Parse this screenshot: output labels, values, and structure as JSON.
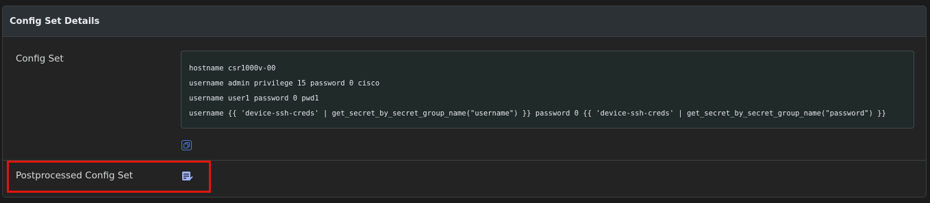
{
  "panel": {
    "title": "Config Set Details"
  },
  "config_set": {
    "label": "Config Set",
    "lines": [
      "hostname csr1000v-00",
      "username admin privilege 15 password 0 cisco",
      "username user1 password 0 pwd1",
      "username {{ 'device-ssh-creds' | get_secret_by_secret_group_name(\"username\") }} password 0 {{ 'device-ssh-creds' | get_secret_by_secret_group_name(\"password\") }}"
    ],
    "copy_icon": "copy-icon"
  },
  "postprocessed": {
    "label": "Postprocessed Config Set",
    "icon": "checklist-document-icon"
  },
  "colors": {
    "accent": "#4b7ad8",
    "icon_fill": "#9fb3ff",
    "highlight": "#e0160c"
  }
}
